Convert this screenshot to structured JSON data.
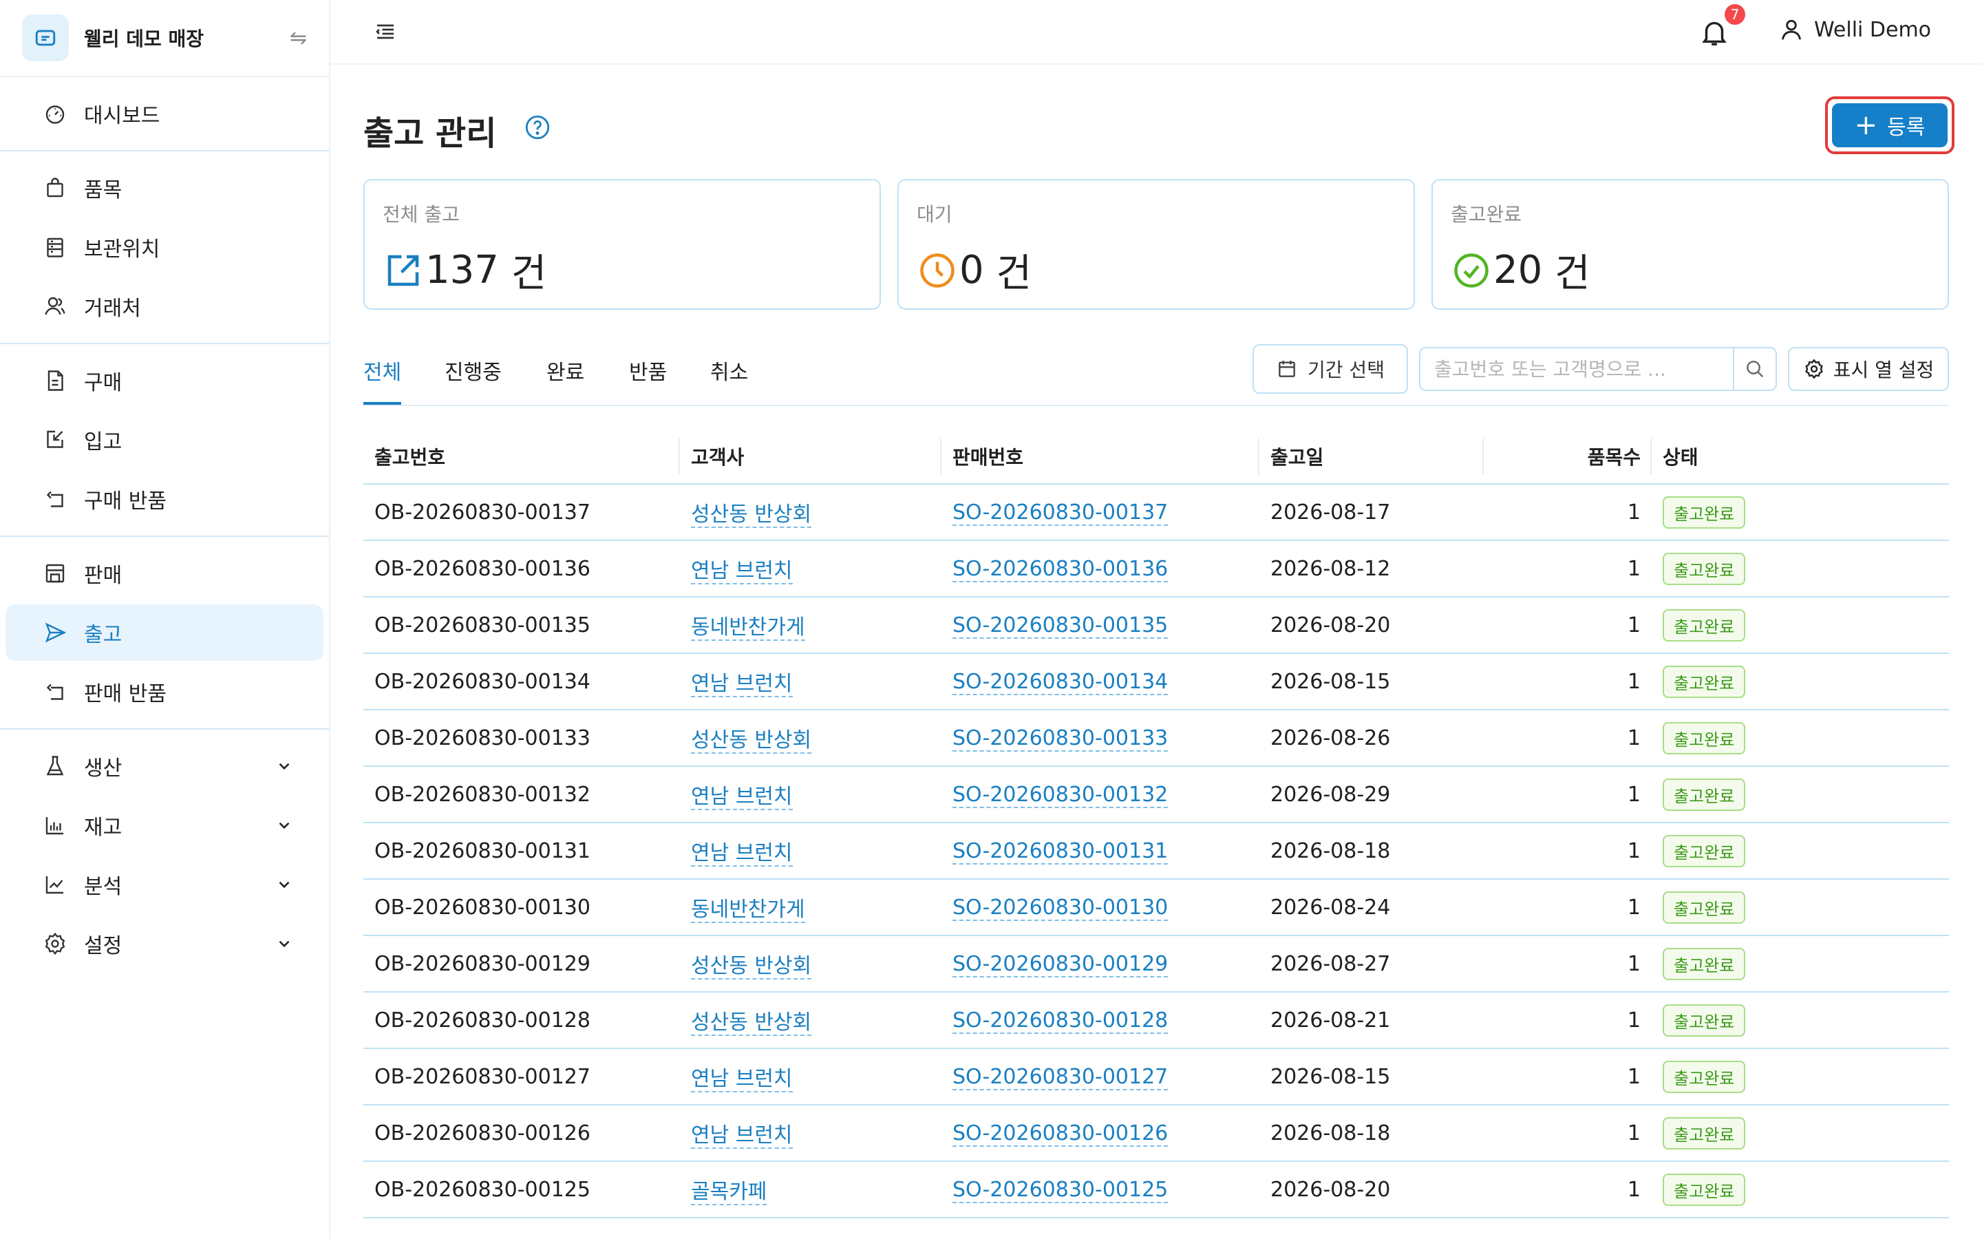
{
  "sidebar": {
    "store_name": "웰리 데모 매장",
    "groups": [
      [
        {
          "label": "대시보드",
          "icon": "dashboard-icon"
        }
      ],
      [
        {
          "label": "품목",
          "icon": "bag-icon"
        },
        {
          "label": "보관위치",
          "icon": "shelf-icon"
        },
        {
          "label": "거래처",
          "icon": "people-icon"
        }
      ],
      [
        {
          "label": "구매",
          "icon": "document-icon"
        },
        {
          "label": "입고",
          "icon": "inbound-icon"
        },
        {
          "label": "구매 반품",
          "icon": "return-icon"
        }
      ],
      [
        {
          "label": "판매",
          "icon": "store-icon"
        },
        {
          "label": "출고",
          "icon": "send-icon"
        },
        {
          "label": "판매 반품",
          "icon": "return-icon"
        }
      ],
      [
        {
          "label": "생산",
          "icon": "flask-icon"
        },
        {
          "label": "재고",
          "icon": "bar-chart-icon"
        },
        {
          "label": "분석",
          "icon": "line-chart-icon"
        },
        {
          "label": "설정",
          "icon": "gear-icon"
        }
      ]
    ]
  },
  "header": {
    "notification_count": "7",
    "user_name": "Welli Demo"
  },
  "page": {
    "title": "출고 관리",
    "register_label": "등록"
  },
  "cards": [
    {
      "label": "전체 출고",
      "value": "137",
      "unit": "건",
      "color": "#1a7fc2",
      "icon": "outbound-icon"
    },
    {
      "label": "대기",
      "value": "0",
      "unit": "건",
      "color": "#f08c1c",
      "icon": "clock-icon"
    },
    {
      "label": "출고완료",
      "value": "20",
      "unit": "건",
      "color": "#52b524",
      "icon": "check-circle-icon"
    }
  ],
  "tabs": [
    "전체",
    "진행중",
    "완료",
    "반품",
    "취소"
  ],
  "toolbar": {
    "period_label": "기간 선택",
    "search_placeholder": "출고번호 또는 고객명으로 ...",
    "columns_label": "표시 열 설정"
  },
  "table": {
    "headers": [
      "출고번호",
      "고객사",
      "판매번호",
      "출고일",
      "품목수",
      "상태"
    ],
    "rows": [
      [
        "OB-20260830-00137",
        "성산동 반상회",
        "SO-20260830-00137",
        "2026-08-17",
        "1",
        "출고완료"
      ],
      [
        "OB-20260830-00136",
        "연남 브런치",
        "SO-20260830-00136",
        "2026-08-12",
        "1",
        "출고완료"
      ],
      [
        "OB-20260830-00135",
        "동네반찬가게",
        "SO-20260830-00135",
        "2026-08-20",
        "1",
        "출고완료"
      ],
      [
        "OB-20260830-00134",
        "연남 브런치",
        "SO-20260830-00134",
        "2026-08-15",
        "1",
        "출고완료"
      ],
      [
        "OB-20260830-00133",
        "성산동 반상회",
        "SO-20260830-00133",
        "2026-08-26",
        "1",
        "출고완료"
      ],
      [
        "OB-20260830-00132",
        "연남 브런치",
        "SO-20260830-00132",
        "2026-08-29",
        "1",
        "출고완료"
      ],
      [
        "OB-20260830-00131",
        "연남 브런치",
        "SO-20260830-00131",
        "2026-08-18",
        "1",
        "출고완료"
      ],
      [
        "OB-20260830-00130",
        "동네반찬가게",
        "SO-20260830-00130",
        "2026-08-24",
        "1",
        "출고완료"
      ],
      [
        "OB-20260830-00129",
        "성산동 반상회",
        "SO-20260830-00129",
        "2026-08-27",
        "1",
        "출고완료"
      ],
      [
        "OB-20260830-00128",
        "성산동 반상회",
        "SO-20260830-00128",
        "2026-08-21",
        "1",
        "출고완료"
      ],
      [
        "OB-20260830-00127",
        "연남 브런치",
        "SO-20260830-00127",
        "2026-08-15",
        "1",
        "출고완료"
      ],
      [
        "OB-20260830-00126",
        "연남 브런치",
        "SO-20260830-00126",
        "2026-08-18",
        "1",
        "출고완료"
      ],
      [
        "OB-20260830-00125",
        "골목카페",
        "SO-20260830-00125",
        "2026-08-20",
        "1",
        "출고완료"
      ]
    ]
  }
}
